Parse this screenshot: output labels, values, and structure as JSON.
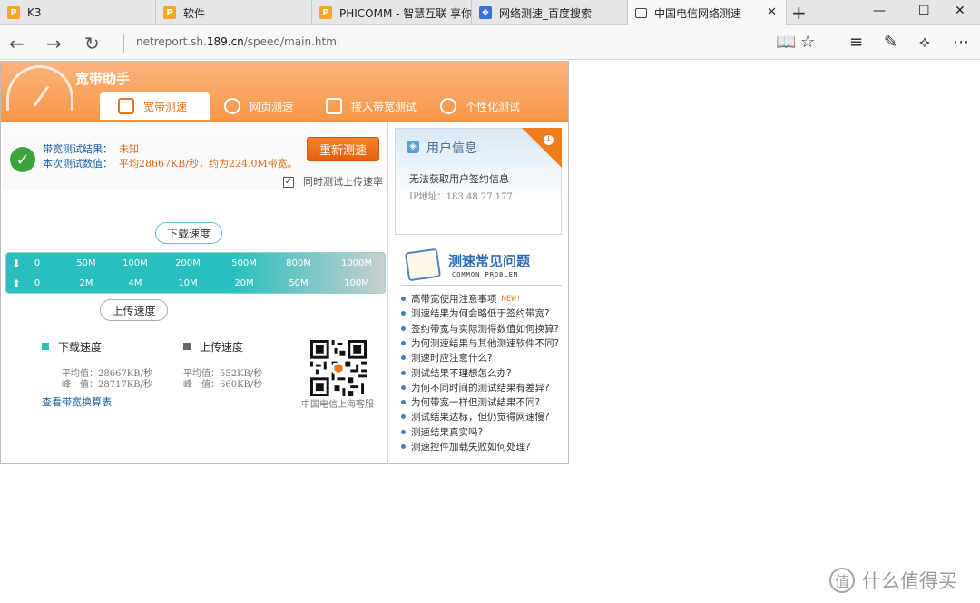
{
  "browser": {
    "tabs": [
      {
        "title": "K3",
        "icon": "pconline-icon"
      },
      {
        "title": "软件",
        "icon": "pconline-icon"
      },
      {
        "title": "PHICOMM - 智慧互联 享你",
        "icon": "pconline-icon"
      },
      {
        "title": "网络测速_百度搜索",
        "icon": "baidu-paw-icon"
      },
      {
        "title": "中国电信网络测速",
        "icon": "page-icon",
        "active": true
      }
    ],
    "url_prefix": "netreport.sh.",
    "url_host": "189.cn",
    "url_path": "/speed/main.html"
  },
  "app": {
    "brand": "宽带助手",
    "nav_tabs": [
      {
        "label": "宽带测速",
        "active": true
      },
      {
        "label": "网页测速"
      },
      {
        "label": "接入带宽测试"
      },
      {
        "label": "个性化测试"
      }
    ]
  },
  "result": {
    "bandwidth_label": "带宽测试结果：",
    "bandwidth_value": "未知",
    "current_label": "本次测试数值：",
    "current_value": "平均28667KB/秒，约为224.0M带宽。",
    "retest_button": "重新测速",
    "upload_checkbox_label": "同时测试上传速率",
    "upload_checkbox_checked": true
  },
  "meter": {
    "download_label": "下载速度",
    "upload_label": "上传速度",
    "download_ticks": [
      "0",
      "50M",
      "100M",
      "200M",
      "500M",
      "800M",
      "1000M"
    ],
    "upload_ticks": [
      "0",
      "2M",
      "4M",
      "10M",
      "20M",
      "50M",
      "100M"
    ],
    "colors": {
      "download": "#29bfbf",
      "upload": "#666666"
    }
  },
  "stats": {
    "download": {
      "title": "下载速度",
      "avg": "平均值：28667KB/秒",
      "peak": "峰　值：28717KB/秒"
    },
    "upload": {
      "title": "上传速度",
      "avg": "平均值：552KB/秒",
      "peak": "峰　值：660KB/秒"
    },
    "convert_link": "查看带宽换算表",
    "qr_caption": "中国电信上海客服"
  },
  "user": {
    "title": "用户信息",
    "message": "无法获取用户签约信息",
    "ip_label": "IP地址：",
    "ip": "183.48.27.177"
  },
  "faq": {
    "title": "测速常见问题",
    "subtitle": "COMMON PROBLEM",
    "new_badge": "NEW!",
    "items": [
      "高带宽使用注意事项",
      "测速结果为何会略低于签约带宽?",
      "签约带宽与实际测得数值如何换算?",
      "为何测速结果与其他测速软件不同?",
      "测速时应注意什么?",
      "测试结果不理想怎么办?",
      "为何不同时间的测试结果有差异?",
      "为何带宽一样但测试结果不同?",
      "测试结果达标，但仍觉得网速慢?",
      "测速结果真实吗?",
      "测速控件加载失败如何处理?"
    ]
  },
  "watermark": "什么值得买"
}
